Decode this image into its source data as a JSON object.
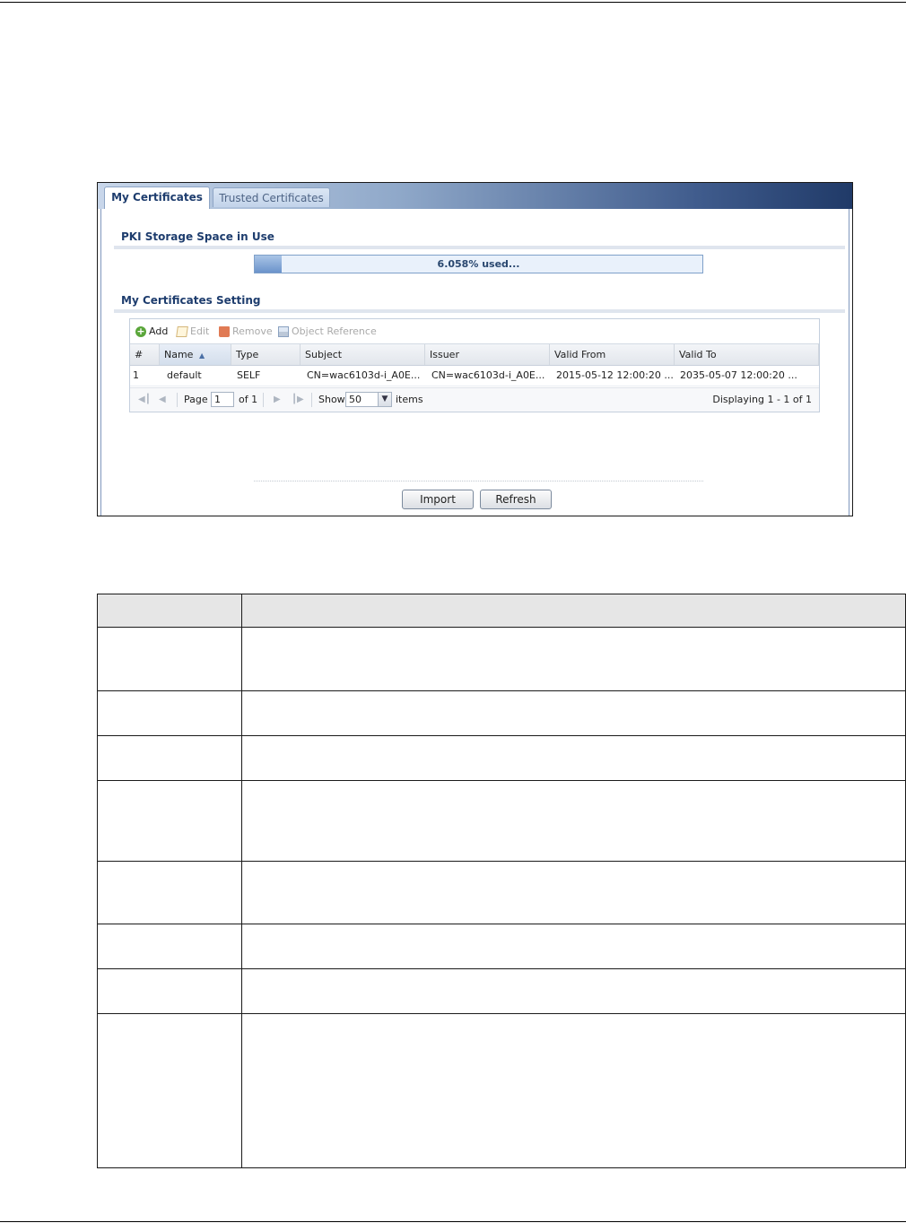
{
  "tabs": [
    {
      "label": "My Certificates",
      "active": true
    },
    {
      "label": "Trusted Certificates",
      "active": false
    }
  ],
  "pki": {
    "title": "PKI Storage Space in Use",
    "used_text": "6.058% used...",
    "used_percent": 6.058
  },
  "settings": {
    "title": "My Certificates Setting",
    "toolbar": {
      "add": "Add",
      "edit": "Edit",
      "remove": "Remove",
      "object_reference": "Object Reference"
    },
    "columns": [
      "#",
      "Name",
      "Type",
      "Subject",
      "Issuer",
      "Valid From",
      "Valid To"
    ],
    "sort_indicator": "▲",
    "rows": [
      {
        "num": "1",
        "name": "default",
        "type": "SELF",
        "subject": "CN=wac6103d-i_A0E...",
        "issuer": "CN=wac6103d-i_A0E...",
        "valid_from": "2015-05-12 12:00:20 ...",
        "valid_to": "2035-05-07 12:00:20 ..."
      }
    ],
    "pager": {
      "page_label": "Page",
      "page_value": "1",
      "of_label": "of 1",
      "show_label": "Show",
      "show_value": "50",
      "items_label": "items",
      "displaying": "Displaying 1 - 1 of 1"
    }
  },
  "buttons": {
    "import": "Import",
    "refresh": "Refresh"
  },
  "colors": {
    "title_blue": "#1e3d6e",
    "tab_bar_dark": "#203a68"
  }
}
